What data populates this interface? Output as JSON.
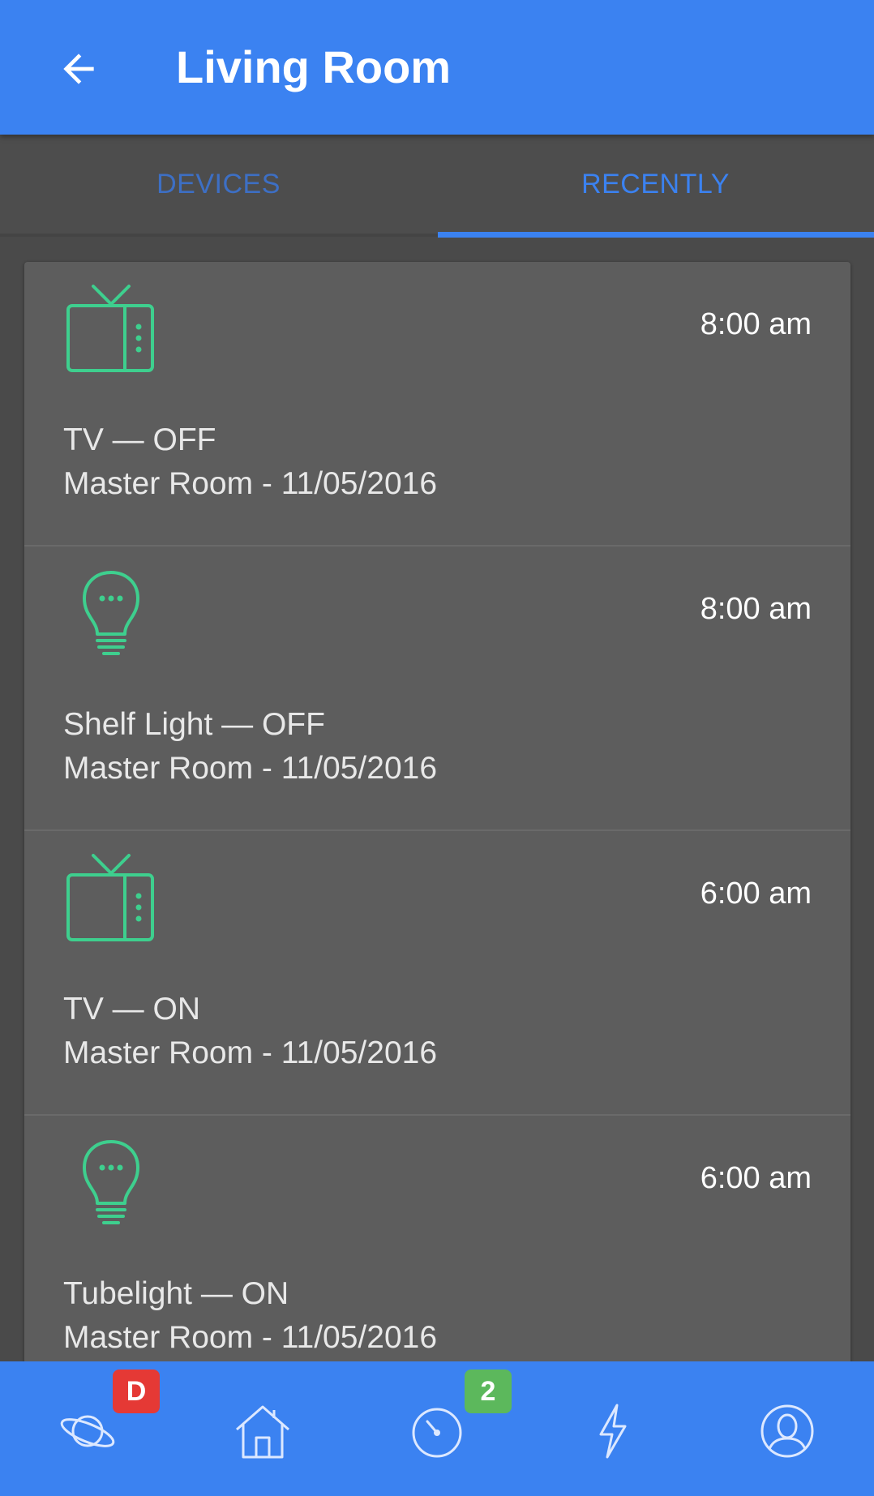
{
  "header": {
    "title": "Living Room",
    "back_icon": "arrow-left-icon"
  },
  "tabs": [
    {
      "label": "DEVICES",
      "active": false
    },
    {
      "label": "RECENTLY",
      "active": true
    }
  ],
  "activity": [
    {
      "icon": "tv-icon",
      "time": "8:00 am",
      "title": "TV — OFF",
      "subtitle": "Master Room - 11/05/2016"
    },
    {
      "icon": "bulb-icon",
      "time": "8:00 am",
      "title": "Shelf Light — OFF",
      "subtitle": "Master Room - 11/05/2016"
    },
    {
      "icon": "tv-icon",
      "time": "6:00 am",
      "title": "TV — ON",
      "subtitle": "Master Room - 11/05/2016"
    },
    {
      "icon": "bulb-icon",
      "time": "6:00 am",
      "title": "Tubelight — ON",
      "subtitle": "Master Room - 11/05/2016"
    }
  ],
  "bottom_nav": {
    "items": [
      {
        "icon": "planet-icon",
        "badge": "D"
      },
      {
        "icon": "home-icon",
        "badge": ""
      },
      {
        "icon": "timer-icon",
        "badge": "2"
      },
      {
        "icon": "lightning-icon",
        "badge": ""
      },
      {
        "icon": "profile-icon",
        "badge": ""
      }
    ]
  },
  "colors": {
    "primary": "#3b82f1",
    "icon_green": "#3ecf8e",
    "badge_red": "#e53935",
    "badge_green": "#5cb85c"
  }
}
